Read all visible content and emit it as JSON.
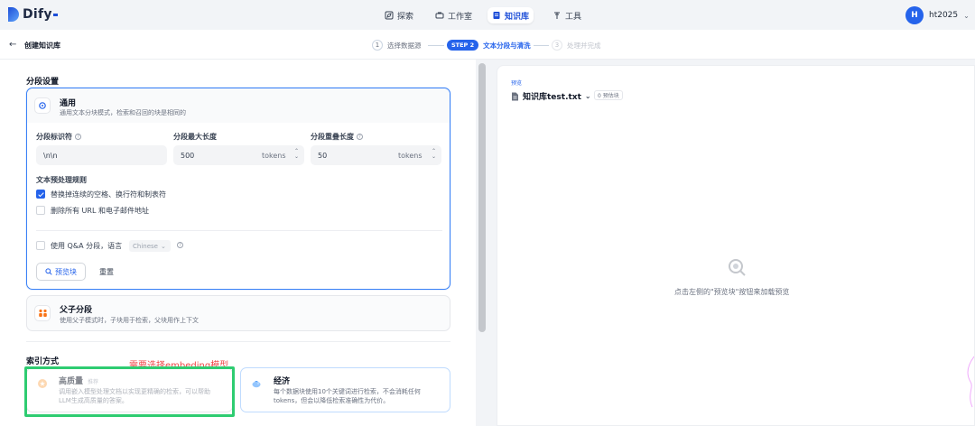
{
  "nav": {
    "brand": "Dify",
    "items": [
      {
        "label": "探索",
        "icon": "explore-icon"
      },
      {
        "label": "工作室",
        "icon": "studio-icon"
      },
      {
        "label": "知识库",
        "icon": "knowledge-icon",
        "active": true
      },
      {
        "label": "工具",
        "icon": "tools-icon"
      }
    ],
    "user": {
      "initial": "H",
      "name": "ht2025"
    }
  },
  "subheader": {
    "back_title": "创建知识库",
    "steps": [
      {
        "num": "1",
        "label": "选择数据源"
      },
      {
        "badge": "STEP 2",
        "label": "文本分段与清洗"
      },
      {
        "num": "3",
        "label": "处理并完成"
      }
    ]
  },
  "segment": {
    "section_title": "分段设置",
    "general": {
      "title": "通用",
      "desc": "通用文本分块模式，检索和召回的块是相同的",
      "separator_label": "分段标识符",
      "separator_value": "\\n\\n",
      "max_len_label": "分段最大长度",
      "max_len_value": "500",
      "overlap_label": "分段重叠长度",
      "overlap_value": "50",
      "unit": "tokens",
      "rules_title": "文本预处理规则",
      "rule1": "替换掉连续的空格、换行符和制表符",
      "rule2": "删除所有 URL 和电子邮件地址",
      "qa_label": "使用 Q&A 分段，语言",
      "qa_lang": "Chinese",
      "preview_btn": "预览块",
      "reset_btn": "重置"
    },
    "parent_child": {
      "title": "父子分段",
      "desc": "使用父子模式时，子块用于检索，父块用作上下文"
    }
  },
  "index": {
    "section_title": "索引方式",
    "annotation": "需要选择embeding模型",
    "high_quality": {
      "title": "高质量",
      "badge": "推荐",
      "desc1": "调用嵌入模型处理文档以实现更精确的检索，可以帮助",
      "desc2": "LLM生成高质量的答案。"
    },
    "economy": {
      "title": "经济",
      "desc1": "每个数据块使用10个关键词进行检索，不会消耗任何",
      "desc2": "tokens，但会以降低检索准确性为代价。"
    }
  },
  "preview": {
    "label": "预览",
    "file_name": "知识库test.txt",
    "chunk_badge": "0 预估块",
    "empty_text": "点击左侧的\"预览块\"按钮来加载预览"
  },
  "colors": {
    "accent": "#2563eb",
    "annotation": "#ef4444",
    "highlight_box": "#2ecc71"
  }
}
